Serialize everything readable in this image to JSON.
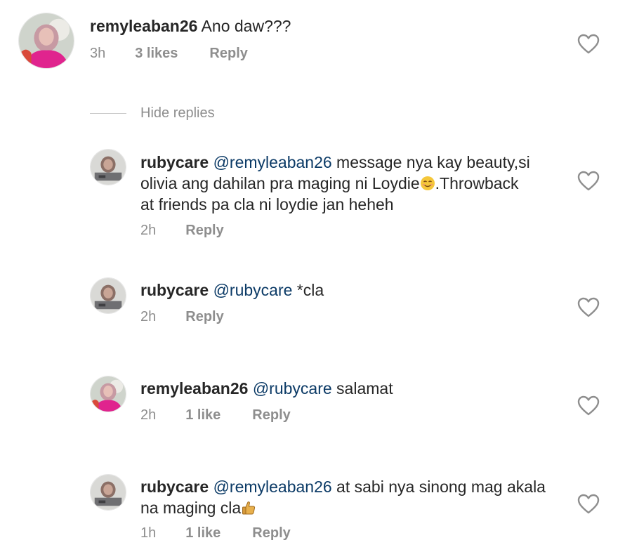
{
  "comments": [
    {
      "username": "remyleaban26",
      "mention": "",
      "text": " Ano daw???",
      "time": "3h",
      "likes": "3 likes",
      "reply": "Reply"
    },
    {
      "username": "rubycare",
      "mention": "@remyleaban26",
      "text_line1": " message nya kay beauty,si",
      "text_line2a": "olivia ang dahilan pra maging ni Loydie",
      "text_line2b": ".Throwback",
      "text_line3": "at friends pa cla ni loydie jan heheh",
      "time": "2h",
      "reply": "Reply"
    },
    {
      "username": "rubycare",
      "mention": "@rubycare",
      "text": " *cla",
      "time": "2h",
      "reply": "Reply"
    },
    {
      "username": "remyleaban26",
      "mention": "@rubycare",
      "text": " salamat",
      "time": "2h",
      "likes": "1 like",
      "reply": "Reply"
    },
    {
      "username": "rubycare",
      "mention": "@remyleaban26",
      "text_line1": " at sabi nya sinong mag akala",
      "text_line2": "na maging cla",
      "time": "1h",
      "likes": "1 like",
      "reply": "Reply"
    }
  ],
  "hide_replies_label": "Hide replies",
  "icons": {
    "like": "heart-outline-icon",
    "smile": "smiling-face-emoji",
    "thumbs_up": "thumbs-up-emoji"
  },
  "colors": {
    "text": "#262626",
    "meta": "#8e8e8e",
    "mention": "#0b3a66",
    "heart": "#8e8e8e"
  }
}
